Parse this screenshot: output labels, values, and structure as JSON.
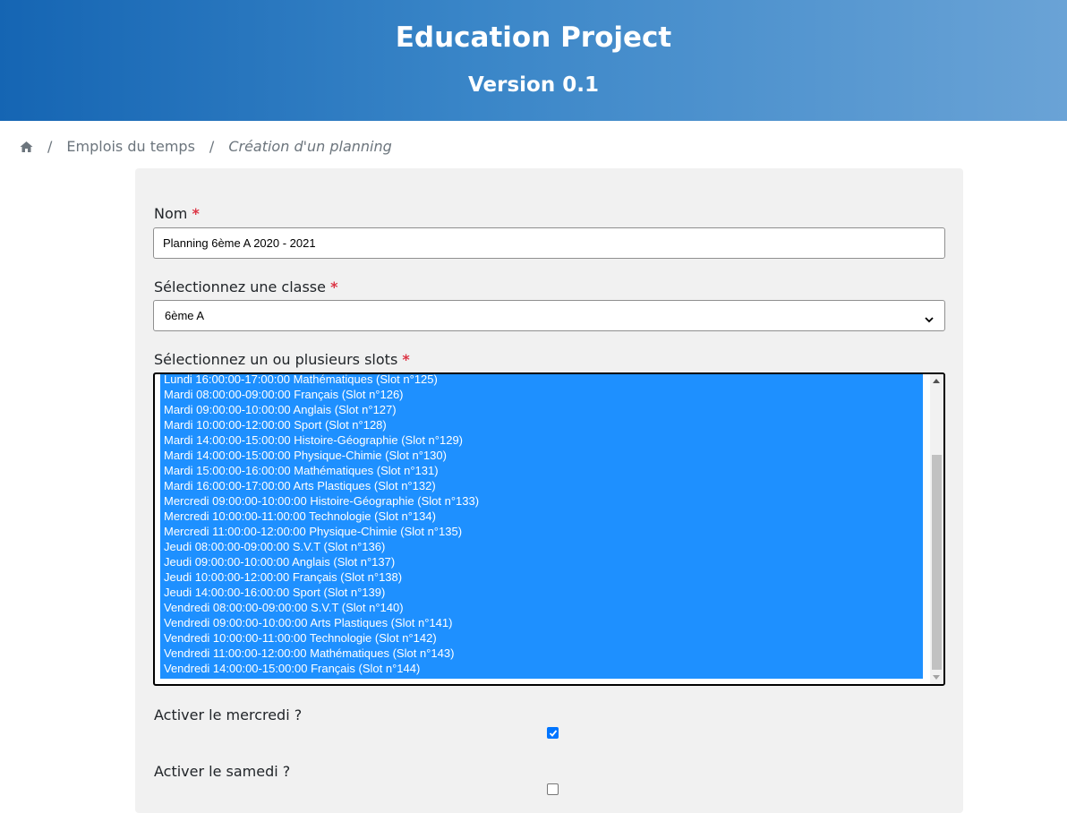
{
  "header": {
    "title": "Education Project",
    "version": "Version 0.1"
  },
  "breadcrumb": {
    "home_icon": "home-icon",
    "items": [
      "Emplois du temps",
      "Création d'un planning"
    ],
    "separator": "/"
  },
  "form": {
    "nom": {
      "label": "Nom",
      "required_mark": "*",
      "value": "Planning 6ème A 2020 - 2021"
    },
    "classe": {
      "label": "Sélectionnez une classe",
      "required_mark": "*",
      "selected": "6ème A"
    },
    "slots": {
      "label": "Sélectionnez un ou plusieurs slots",
      "required_mark": "*",
      "options": [
        "Lundi 16:00:00-17:00:00 Mathématiques (Slot n°125)",
        "Mardi 08:00:00-09:00:00 Français (Slot n°126)",
        "Mardi 09:00:00-10:00:00 Anglais (Slot n°127)",
        "Mardi 10:00:00-12:00:00 Sport (Slot n°128)",
        "Mardi 14:00:00-15:00:00 Histoire-Géographie (Slot n°129)",
        "Mardi 14:00:00-15:00:00 Physique-Chimie (Slot n°130)",
        "Mardi 15:00:00-16:00:00 Mathématiques (Slot n°131)",
        "Mardi 16:00:00-17:00:00 Arts Plastiques (Slot n°132)",
        "Mercredi 09:00:00-10:00:00 Histoire-Géographie (Slot n°133)",
        "Mercredi 10:00:00-11:00:00 Technologie (Slot n°134)",
        "Mercredi 11:00:00-12:00:00 Physique-Chimie (Slot n°135)",
        "Jeudi 08:00:00-09:00:00 S.V.T (Slot n°136)",
        "Jeudi 09:00:00-10:00:00 Anglais (Slot n°137)",
        "Jeudi 10:00:00-12:00:00 Français (Slot n°138)",
        "Jeudi 14:00:00-16:00:00 Sport (Slot n°139)",
        "Vendredi 08:00:00-09:00:00 S.V.T (Slot n°140)",
        "Vendredi 09:00:00-10:00:00 Arts Plastiques (Slot n°141)",
        "Vendredi 10:00:00-11:00:00 Technologie (Slot n°142)",
        "Vendredi 11:00:00-12:00:00 Mathématiques (Slot n°143)",
        "Vendredi 14:00:00-15:00:00 Français (Slot n°144)"
      ]
    },
    "mercredi": {
      "label": "Activer le mercredi ?",
      "checked": true
    },
    "samedi": {
      "label": "Activer le samedi ?",
      "checked": false
    }
  },
  "colors": {
    "header_start": "#1565b3",
    "header_end": "#6aa3d6",
    "selection": "#1e90ff",
    "required": "#dc3545",
    "checkbox_checked": "#0075ff"
  }
}
